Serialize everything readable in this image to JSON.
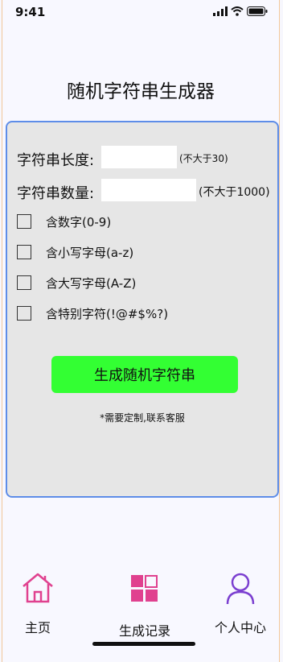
{
  "status_bar": {
    "time": "9:41",
    "icons": [
      "signal-icon",
      "wifi-icon",
      "battery-icon"
    ]
  },
  "page": {
    "title": "随机字符串生成器"
  },
  "form": {
    "length_label": "字符串长度:",
    "length_value": "",
    "length_hint": "(不大于30)",
    "count_label": "字符串数量:",
    "count_value": "",
    "count_hint": "(不大于1000)",
    "options": [
      {
        "label": "含数字(0-9)",
        "checked": false
      },
      {
        "label": "含小写字母(a-z)",
        "checked": false
      },
      {
        "label": "含大写字母(A-Z)",
        "checked": false
      },
      {
        "label": "含特别字符(!@#$%?)",
        "checked": false
      }
    ],
    "generate_button": "生成随机字符串",
    "note": "*需要定制,联系客服"
  },
  "tabbar": {
    "items": [
      {
        "label": "主页",
        "icon": "home-icon",
        "color": "#e0418f"
      },
      {
        "label": "生成记录",
        "icon": "grid-icon",
        "color": "#e0418f"
      },
      {
        "label": "个人中心",
        "icon": "user-icon",
        "color": "#7b3fd0"
      }
    ]
  },
  "colors": {
    "panel_border": "#5e8de8",
    "button_bg": "#33ff33",
    "accent_pink": "#e0418f",
    "accent_purple": "#7b3fd0"
  }
}
